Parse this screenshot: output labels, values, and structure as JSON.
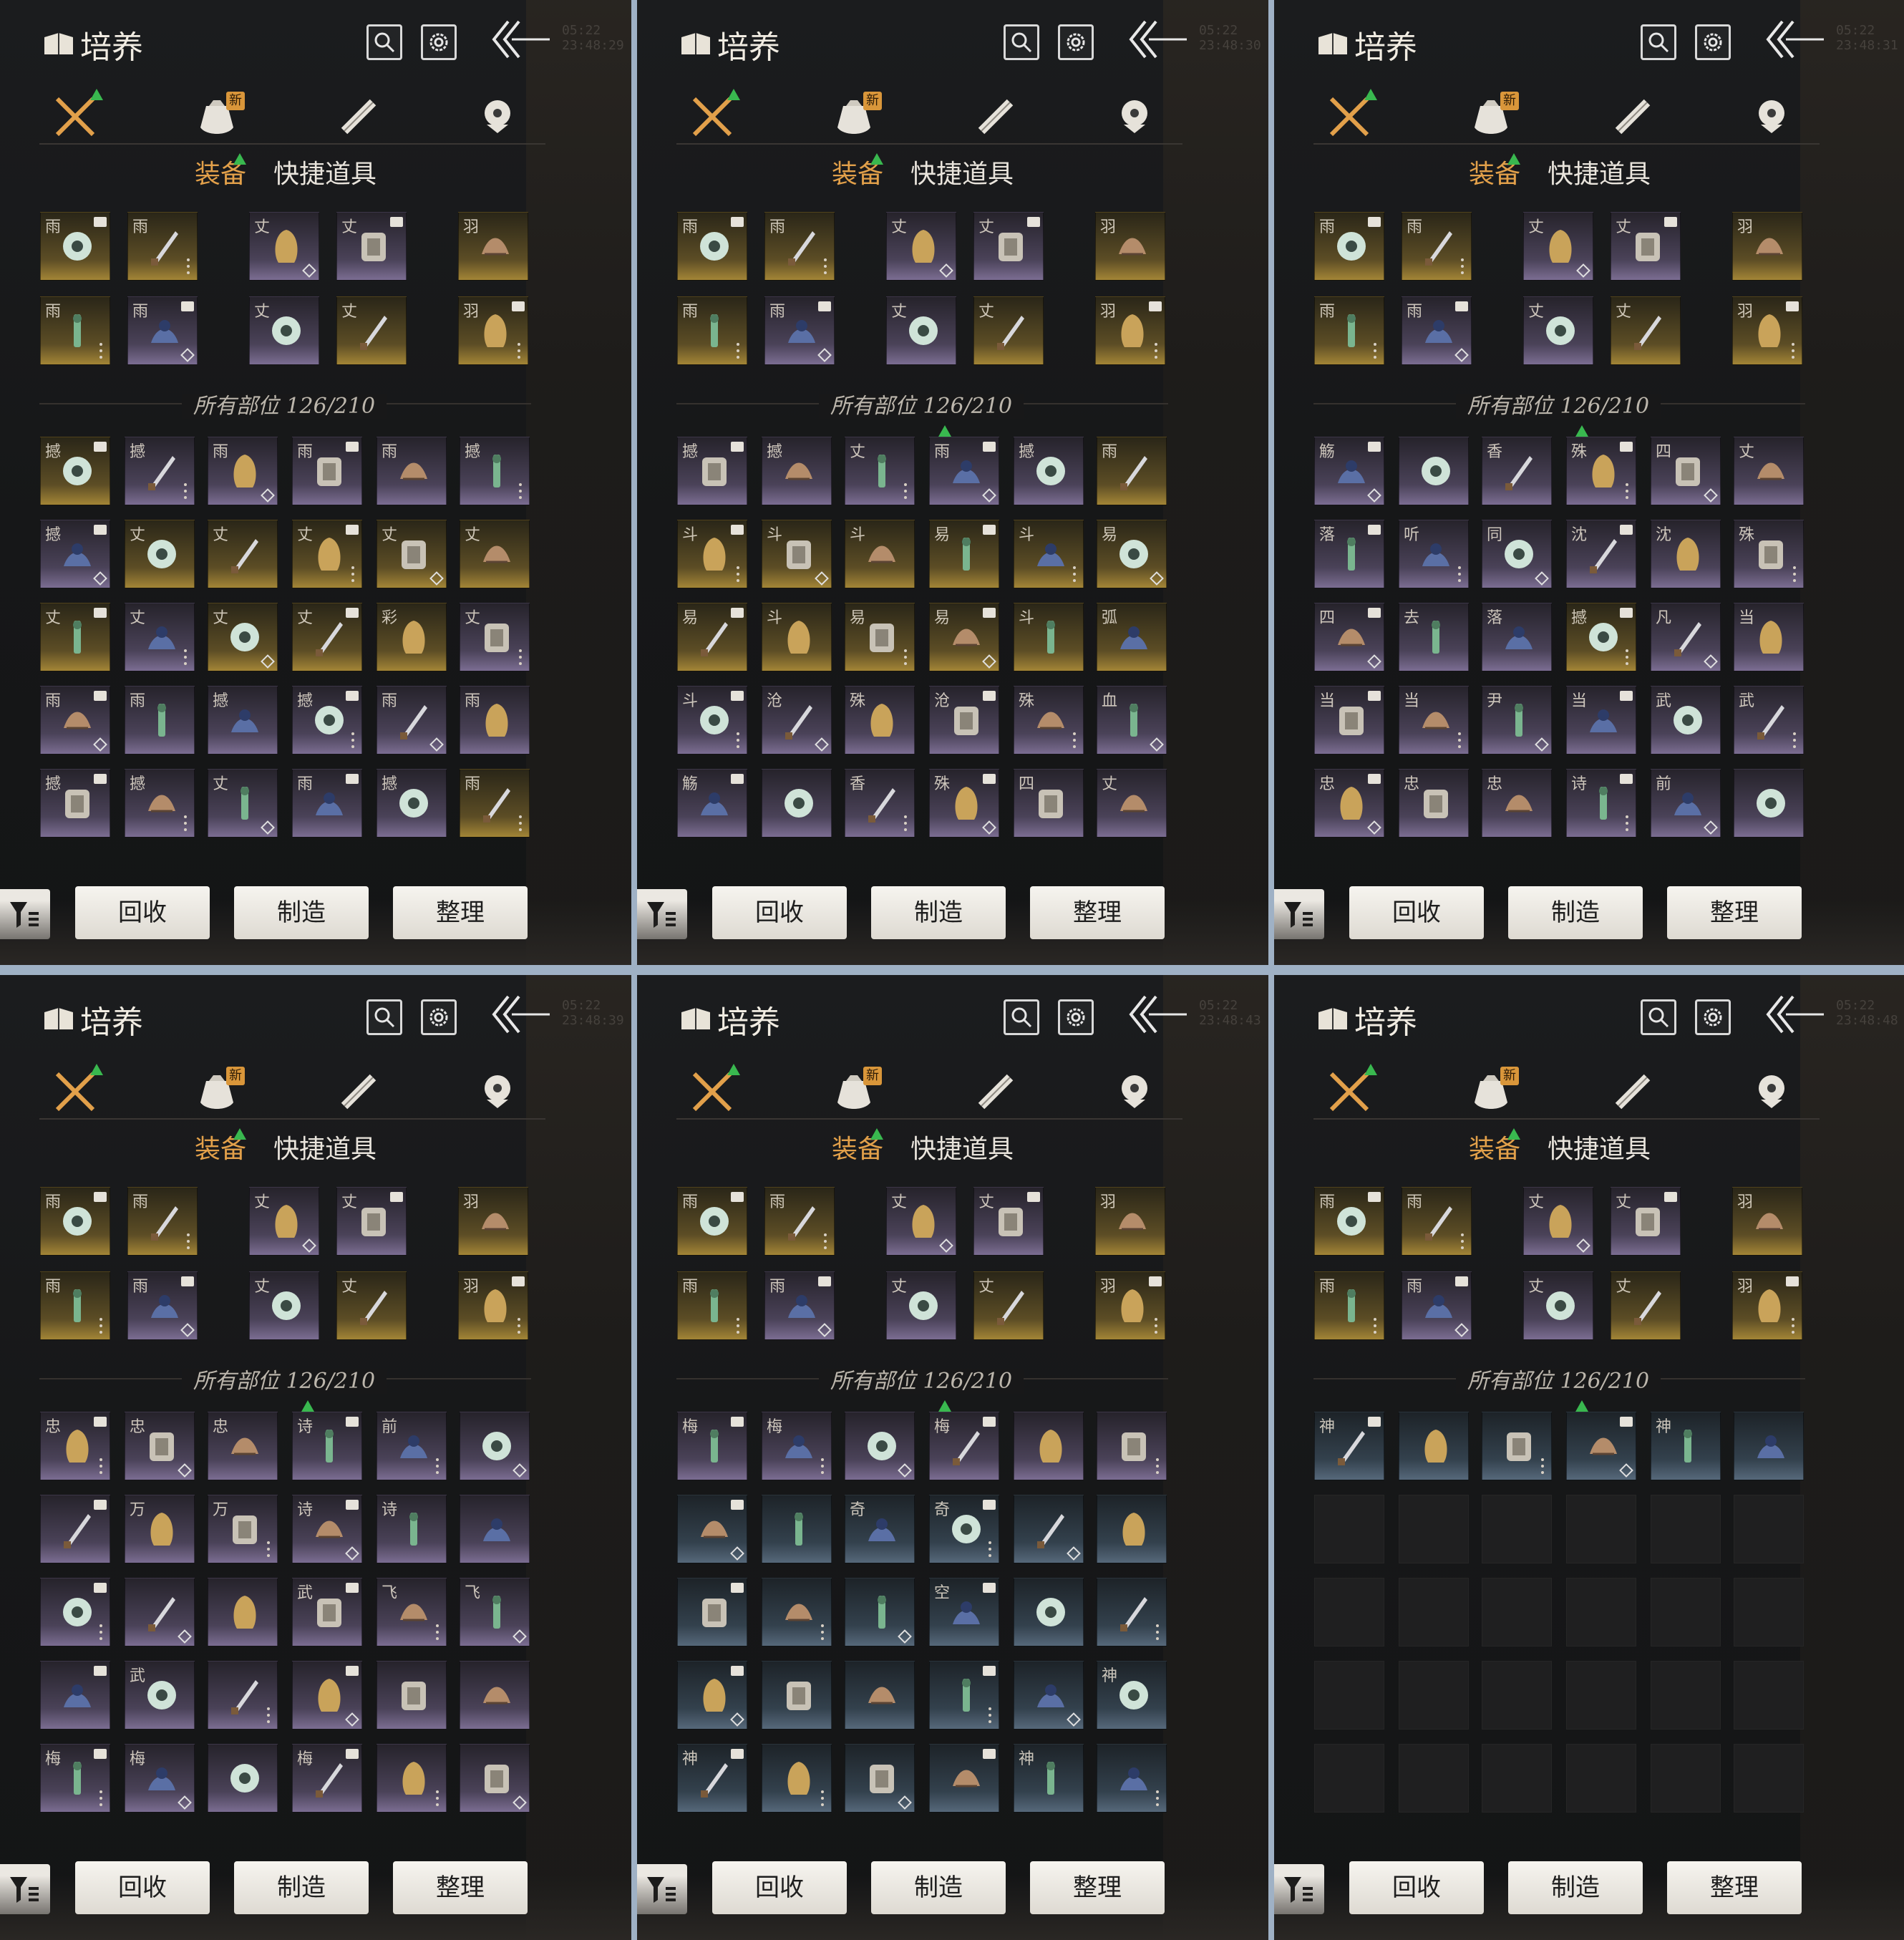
{
  "title": "培养",
  "subtabs": [
    "装备",
    "快捷道具"
  ],
  "count_label": "所有部位 126/210",
  "buttons": [
    "回收",
    "制造",
    "整理"
  ],
  "new_badge": "新",
  "timestamps": [
    "05:22 23:48:29",
    "05:22 23:48:30",
    "05:22 23:48:31",
    "05:22 23:48:39",
    "05:22 23:48:43",
    "05:22 23:48:48"
  ],
  "colors": {
    "accent": "#e2a04a",
    "highlight": "#39b84f",
    "gold_cell": "#a38536",
    "purple_cell": "#7b6d92",
    "blue_cell": "#56687a"
  },
  "panels": [
    {
      "equipped": [
        {
          "glyph": "雨",
          "rarity": "gold"
        },
        {
          "glyph": "雨",
          "rarity": "gold"
        },
        {
          "glyph": "丈",
          "rarity": "purple"
        },
        {
          "glyph": "丈",
          "rarity": "purple"
        },
        {
          "glyph": "羽",
          "rarity": "gold"
        },
        {
          "glyph": "雨",
          "rarity": "gold"
        },
        {
          "glyph": "雨",
          "rarity": "purple"
        },
        {
          "glyph": "丈",
          "rarity": "purple"
        },
        {
          "glyph": "丈",
          "rarity": "gold"
        },
        {
          "glyph": "羽",
          "rarity": "gold"
        }
      ],
      "inventory": [
        {
          "glyph": "撼",
          "rarity": "gold"
        },
        {
          "glyph": "撼",
          "rarity": "purple"
        },
        {
          "glyph": "雨",
          "rarity": "purple"
        },
        {
          "glyph": "雨",
          "rarity": "purple"
        },
        {
          "glyph": "雨",
          "rarity": "purple"
        },
        {
          "glyph": "撼",
          "rarity": "purple"
        },
        {
          "glyph": "撼",
          "rarity": "purple"
        },
        {
          "glyph": "丈",
          "rarity": "gold"
        },
        {
          "glyph": "丈",
          "rarity": "gold"
        },
        {
          "glyph": "丈",
          "rarity": "gold"
        },
        {
          "glyph": "丈",
          "rarity": "gold"
        },
        {
          "glyph": "丈",
          "rarity": "gold"
        },
        {
          "glyph": "丈",
          "rarity": "gold"
        },
        {
          "glyph": "丈",
          "rarity": "purple"
        },
        {
          "glyph": "丈",
          "rarity": "gold"
        },
        {
          "glyph": "丈",
          "rarity": "gold"
        },
        {
          "glyph": "彩",
          "rarity": "gold"
        },
        {
          "glyph": "丈",
          "rarity": "purple"
        },
        {
          "glyph": "雨",
          "rarity": "purple"
        },
        {
          "glyph": "雨",
          "rarity": "purple"
        },
        {
          "glyph": "撼",
          "rarity": "purple"
        },
        {
          "glyph": "撼",
          "rarity": "purple"
        },
        {
          "glyph": "雨",
          "rarity": "purple"
        },
        {
          "glyph": "雨",
          "rarity": "purple"
        },
        {
          "glyph": "撼",
          "rarity": "purple"
        },
        {
          "glyph": "撼",
          "rarity": "purple"
        },
        {
          "glyph": "丈",
          "rarity": "purple"
        },
        {
          "glyph": "雨",
          "rarity": "purple"
        },
        {
          "glyph": "撼",
          "rarity": "purple"
        },
        {
          "glyph": "雨",
          "rarity": "gold"
        }
      ]
    },
    {
      "equipped": [
        {
          "glyph": "雨",
          "rarity": "gold"
        },
        {
          "glyph": "雨",
          "rarity": "gold"
        },
        {
          "glyph": "丈",
          "rarity": "purple"
        },
        {
          "glyph": "丈",
          "rarity": "purple"
        },
        {
          "glyph": "羽",
          "rarity": "gold"
        },
        {
          "glyph": "雨",
          "rarity": "gold"
        },
        {
          "glyph": "雨",
          "rarity": "purple"
        },
        {
          "glyph": "丈",
          "rarity": "purple"
        },
        {
          "glyph": "丈",
          "rarity": "gold"
        },
        {
          "glyph": "羽",
          "rarity": "gold"
        }
      ],
      "inventory": [
        {
          "glyph": "撼",
          "rarity": "purple"
        },
        {
          "glyph": "撼",
          "rarity": "purple"
        },
        {
          "glyph": "丈",
          "rarity": "purple"
        },
        {
          "glyph": "雨",
          "rarity": "purple"
        },
        {
          "glyph": "撼",
          "rarity": "purple"
        },
        {
          "glyph": "雨",
          "rarity": "gold"
        },
        {
          "glyph": "斗",
          "rarity": "gold"
        },
        {
          "glyph": "斗",
          "rarity": "gold"
        },
        {
          "glyph": "斗",
          "rarity": "gold"
        },
        {
          "glyph": "易",
          "rarity": "gold"
        },
        {
          "glyph": "斗",
          "rarity": "gold"
        },
        {
          "glyph": "易",
          "rarity": "gold"
        },
        {
          "glyph": "易",
          "rarity": "gold"
        },
        {
          "glyph": "斗",
          "rarity": "gold"
        },
        {
          "glyph": "易",
          "rarity": "gold"
        },
        {
          "glyph": "易",
          "rarity": "gold"
        },
        {
          "glyph": "斗",
          "rarity": "gold"
        },
        {
          "glyph": "弧",
          "rarity": "gold"
        },
        {
          "glyph": "斗",
          "rarity": "purple"
        },
        {
          "glyph": "沧",
          "rarity": "purple"
        },
        {
          "glyph": "殊",
          "rarity": "purple"
        },
        {
          "glyph": "沧",
          "rarity": "purple"
        },
        {
          "glyph": "殊",
          "rarity": "purple"
        },
        {
          "glyph": "血",
          "rarity": "purple"
        },
        {
          "glyph": "觞",
          "rarity": "purple"
        },
        {
          "glyph": "",
          "rarity": "purple"
        },
        {
          "glyph": "香",
          "rarity": "purple"
        },
        {
          "glyph": "殊",
          "rarity": "purple"
        },
        {
          "glyph": "四",
          "rarity": "purple"
        },
        {
          "glyph": "丈",
          "rarity": "purple"
        }
      ]
    },
    {
      "equipped": [
        {
          "glyph": "雨",
          "rarity": "gold"
        },
        {
          "glyph": "雨",
          "rarity": "gold"
        },
        {
          "glyph": "丈",
          "rarity": "purple"
        },
        {
          "glyph": "丈",
          "rarity": "purple"
        },
        {
          "glyph": "羽",
          "rarity": "gold"
        },
        {
          "glyph": "雨",
          "rarity": "gold"
        },
        {
          "glyph": "雨",
          "rarity": "purple"
        },
        {
          "glyph": "丈",
          "rarity": "purple"
        },
        {
          "glyph": "丈",
          "rarity": "gold"
        },
        {
          "glyph": "羽",
          "rarity": "gold"
        }
      ],
      "inventory": [
        {
          "glyph": "觞",
          "rarity": "purple"
        },
        {
          "glyph": "",
          "rarity": "purple"
        },
        {
          "glyph": "香",
          "rarity": "purple"
        },
        {
          "glyph": "殊",
          "rarity": "purple"
        },
        {
          "glyph": "四",
          "rarity": "purple"
        },
        {
          "glyph": "丈",
          "rarity": "purple"
        },
        {
          "glyph": "落",
          "rarity": "purple"
        },
        {
          "glyph": "听",
          "rarity": "purple"
        },
        {
          "glyph": "同",
          "rarity": "purple"
        },
        {
          "glyph": "沈",
          "rarity": "purple"
        },
        {
          "glyph": "沈",
          "rarity": "purple"
        },
        {
          "glyph": "殊",
          "rarity": "purple"
        },
        {
          "glyph": "四",
          "rarity": "purple"
        },
        {
          "glyph": "去",
          "rarity": "purple"
        },
        {
          "glyph": "落",
          "rarity": "purple"
        },
        {
          "glyph": "撼",
          "rarity": "gold"
        },
        {
          "glyph": "凡",
          "rarity": "purple"
        },
        {
          "glyph": "当",
          "rarity": "purple"
        },
        {
          "glyph": "当",
          "rarity": "purple"
        },
        {
          "glyph": "当",
          "rarity": "purple"
        },
        {
          "glyph": "尹",
          "rarity": "purple"
        },
        {
          "glyph": "当",
          "rarity": "purple"
        },
        {
          "glyph": "武",
          "rarity": "purple"
        },
        {
          "glyph": "武",
          "rarity": "purple"
        },
        {
          "glyph": "忠",
          "rarity": "purple"
        },
        {
          "glyph": "忠",
          "rarity": "purple"
        },
        {
          "glyph": "忠",
          "rarity": "purple"
        },
        {
          "glyph": "诗",
          "rarity": "purple"
        },
        {
          "glyph": "前",
          "rarity": "purple"
        },
        {
          "glyph": "",
          "rarity": "purple"
        }
      ]
    },
    {
      "equipped": [
        {
          "glyph": "雨",
          "rarity": "gold"
        },
        {
          "glyph": "雨",
          "rarity": "gold"
        },
        {
          "glyph": "丈",
          "rarity": "purple"
        },
        {
          "glyph": "丈",
          "rarity": "purple"
        },
        {
          "glyph": "羽",
          "rarity": "gold"
        },
        {
          "glyph": "雨",
          "rarity": "gold"
        },
        {
          "glyph": "雨",
          "rarity": "purple"
        },
        {
          "glyph": "丈",
          "rarity": "purple"
        },
        {
          "glyph": "丈",
          "rarity": "gold"
        },
        {
          "glyph": "羽",
          "rarity": "gold"
        }
      ],
      "inventory": [
        {
          "glyph": "忠",
          "rarity": "purple"
        },
        {
          "glyph": "忠",
          "rarity": "purple"
        },
        {
          "glyph": "忠",
          "rarity": "purple"
        },
        {
          "glyph": "诗",
          "rarity": "purple"
        },
        {
          "glyph": "前",
          "rarity": "purple"
        },
        {
          "glyph": "",
          "rarity": "purple"
        },
        {
          "glyph": "",
          "rarity": "purple"
        },
        {
          "glyph": "万",
          "rarity": "purple"
        },
        {
          "glyph": "万",
          "rarity": "purple"
        },
        {
          "glyph": "诗",
          "rarity": "purple"
        },
        {
          "glyph": "诗",
          "rarity": "purple"
        },
        {
          "glyph": "",
          "rarity": "purple"
        },
        {
          "glyph": "",
          "rarity": "purple"
        },
        {
          "glyph": "",
          "rarity": "purple"
        },
        {
          "glyph": "",
          "rarity": "purple"
        },
        {
          "glyph": "武",
          "rarity": "purple"
        },
        {
          "glyph": "飞",
          "rarity": "purple"
        },
        {
          "glyph": "飞",
          "rarity": "purple"
        },
        {
          "glyph": "",
          "rarity": "purple"
        },
        {
          "glyph": "武",
          "rarity": "purple"
        },
        {
          "glyph": "",
          "rarity": "purple"
        },
        {
          "glyph": "",
          "rarity": "purple"
        },
        {
          "glyph": "",
          "rarity": "purple"
        },
        {
          "glyph": "",
          "rarity": "purple"
        },
        {
          "glyph": "梅",
          "rarity": "purple"
        },
        {
          "glyph": "梅",
          "rarity": "purple"
        },
        {
          "glyph": "",
          "rarity": "purple"
        },
        {
          "glyph": "梅",
          "rarity": "purple"
        },
        {
          "glyph": "",
          "rarity": "purple"
        },
        {
          "glyph": "",
          "rarity": "purple"
        }
      ]
    },
    {
      "equipped": [
        {
          "glyph": "雨",
          "rarity": "gold"
        },
        {
          "glyph": "雨",
          "rarity": "gold"
        },
        {
          "glyph": "丈",
          "rarity": "purple"
        },
        {
          "glyph": "丈",
          "rarity": "purple"
        },
        {
          "glyph": "羽",
          "rarity": "gold"
        },
        {
          "glyph": "雨",
          "rarity": "gold"
        },
        {
          "glyph": "雨",
          "rarity": "purple"
        },
        {
          "glyph": "丈",
          "rarity": "purple"
        },
        {
          "glyph": "丈",
          "rarity": "gold"
        },
        {
          "glyph": "羽",
          "rarity": "gold"
        }
      ],
      "inventory": [
        {
          "glyph": "梅",
          "rarity": "purple"
        },
        {
          "glyph": "梅",
          "rarity": "purple"
        },
        {
          "glyph": "",
          "rarity": "purple"
        },
        {
          "glyph": "梅",
          "rarity": "purple"
        },
        {
          "glyph": "",
          "rarity": "purple"
        },
        {
          "glyph": "",
          "rarity": "purple"
        },
        {
          "glyph": "",
          "rarity": "blue"
        },
        {
          "glyph": "",
          "rarity": "blue"
        },
        {
          "glyph": "奇",
          "rarity": "blue"
        },
        {
          "glyph": "奇",
          "rarity": "blue"
        },
        {
          "glyph": "",
          "rarity": "blue"
        },
        {
          "glyph": "",
          "rarity": "blue"
        },
        {
          "glyph": "",
          "rarity": "blue"
        },
        {
          "glyph": "",
          "rarity": "blue"
        },
        {
          "glyph": "",
          "rarity": "blue"
        },
        {
          "glyph": "空",
          "rarity": "blue"
        },
        {
          "glyph": "",
          "rarity": "blue"
        },
        {
          "glyph": "",
          "rarity": "blue"
        },
        {
          "glyph": "",
          "rarity": "blue"
        },
        {
          "glyph": "",
          "rarity": "blue"
        },
        {
          "glyph": "",
          "rarity": "blue"
        },
        {
          "glyph": "",
          "rarity": "blue"
        },
        {
          "glyph": "",
          "rarity": "blue"
        },
        {
          "glyph": "神",
          "rarity": "blue"
        },
        {
          "glyph": "神",
          "rarity": "blue"
        },
        {
          "glyph": "",
          "rarity": "blue"
        },
        {
          "glyph": "",
          "rarity": "blue"
        },
        {
          "glyph": "",
          "rarity": "blue"
        },
        {
          "glyph": "神",
          "rarity": "blue"
        },
        {
          "glyph": "",
          "rarity": "blue"
        }
      ]
    },
    {
      "equipped": [
        {
          "glyph": "雨",
          "rarity": "gold"
        },
        {
          "glyph": "雨",
          "rarity": "gold"
        },
        {
          "glyph": "丈",
          "rarity": "purple"
        },
        {
          "glyph": "丈",
          "rarity": "purple"
        },
        {
          "glyph": "羽",
          "rarity": "gold"
        },
        {
          "glyph": "雨",
          "rarity": "gold"
        },
        {
          "glyph": "雨",
          "rarity": "purple"
        },
        {
          "glyph": "丈",
          "rarity": "purple"
        },
        {
          "glyph": "丈",
          "rarity": "gold"
        },
        {
          "glyph": "羽",
          "rarity": "gold"
        }
      ],
      "inventory": [
        {
          "glyph": "神",
          "rarity": "blue"
        },
        {
          "glyph": "",
          "rarity": "blue"
        },
        {
          "glyph": "",
          "rarity": "blue"
        },
        {
          "glyph": "",
          "rarity": "blue"
        },
        {
          "glyph": "神",
          "rarity": "blue"
        },
        {
          "glyph": "",
          "rarity": "blue"
        },
        {
          "glyph": "",
          "rarity": "empty"
        },
        {
          "glyph": "",
          "rarity": "empty"
        },
        {
          "glyph": "",
          "rarity": "empty"
        },
        {
          "glyph": "",
          "rarity": "empty"
        },
        {
          "glyph": "",
          "rarity": "empty"
        },
        {
          "glyph": "",
          "rarity": "empty"
        },
        {
          "glyph": "",
          "rarity": "empty"
        },
        {
          "glyph": "",
          "rarity": "empty"
        },
        {
          "glyph": "",
          "rarity": "empty"
        },
        {
          "glyph": "",
          "rarity": "empty"
        },
        {
          "glyph": "",
          "rarity": "empty"
        },
        {
          "glyph": "",
          "rarity": "empty"
        },
        {
          "glyph": "",
          "rarity": "empty"
        },
        {
          "glyph": "",
          "rarity": "empty"
        },
        {
          "glyph": "",
          "rarity": "empty"
        },
        {
          "glyph": "",
          "rarity": "empty"
        },
        {
          "glyph": "",
          "rarity": "empty"
        },
        {
          "glyph": "",
          "rarity": "empty"
        },
        {
          "glyph": "",
          "rarity": "empty"
        },
        {
          "glyph": "",
          "rarity": "empty"
        },
        {
          "glyph": "",
          "rarity": "empty"
        },
        {
          "glyph": "",
          "rarity": "empty"
        },
        {
          "glyph": "",
          "rarity": "empty"
        },
        {
          "glyph": "",
          "rarity": "empty"
        }
      ]
    }
  ]
}
